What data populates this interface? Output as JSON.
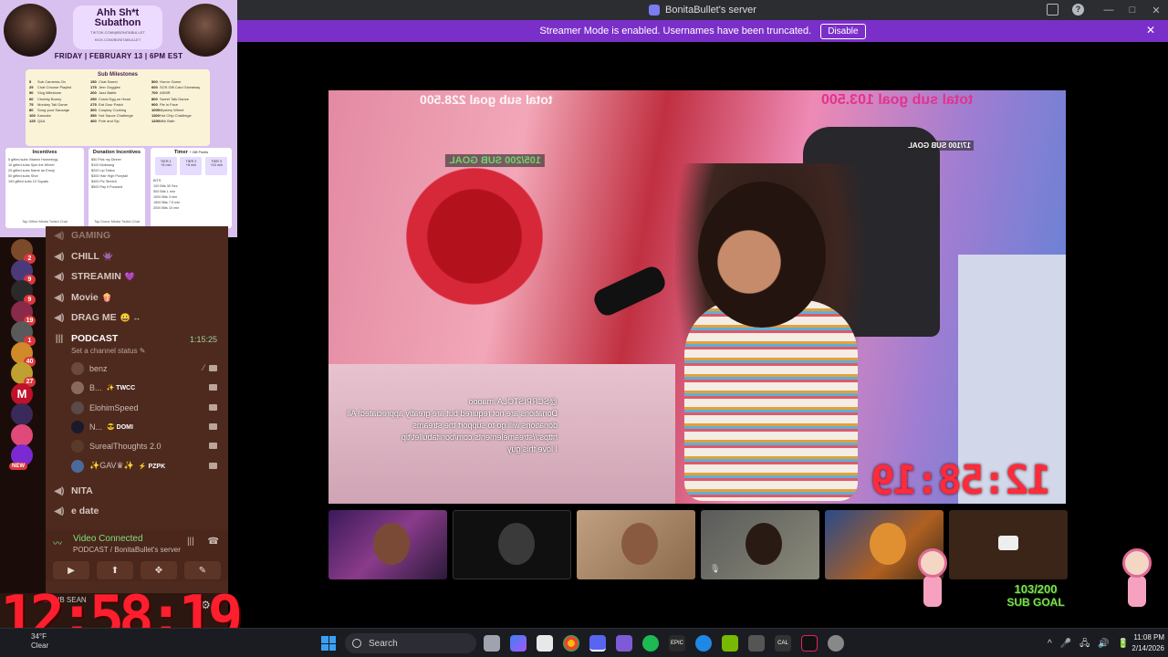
{
  "window": {
    "title": "BonitaBullet's server",
    "controls": [
      "—",
      "□",
      "✕"
    ]
  },
  "streamer_bar": {
    "message": "Streamer Mode is enabled. Usernames have been truncated.",
    "disable_label": "Disable",
    "close": "✕"
  },
  "poster": {
    "title": "Ahh Sh*t Subathon",
    "handle_tiktok": "TIKTOK.COM/@BONITABULLET",
    "handle_kick": "KICK.COM/BONITABULLET",
    "date": "FRIDAY | FEBRUARY 13 | 6PM EST",
    "milestones_title": "Sub Milestones",
    "milestones": [
      [
        [
          "5",
          "Sub Cameras On"
        ],
        [
          "25",
          "Chat Choose Playlist"
        ],
        [
          "50",
          "Vlog Milestone"
        ],
        [
          "60",
          "Chubby Bunny"
        ],
        [
          "75",
          "Monkey Tail Game"
        ],
        [
          "80",
          "Song your Sausage"
        ],
        [
          "100",
          "Karaoke"
        ],
        [
          "125",
          "Q&A"
        ]
      ],
      [
        [
          "150",
          "Chat Sweet"
        ],
        [
          "175",
          "Jeer Goggles"
        ],
        [
          "200",
          "Jazz Battle"
        ],
        [
          "250",
          "Crack Egg on Head"
        ],
        [
          "275",
          "Eat Sour Patch"
        ],
        [
          "300",
          "Cosplay Cooking"
        ],
        [
          "350",
          "Hot Sauce Challenge"
        ],
        [
          "400",
          "Pole and Sip"
        ]
      ],
      [
        [
          "500",
          "Horror Game"
        ],
        [
          "600",
          "SOS Gift Card Giveaway"
        ],
        [
          "700",
          "ASMR"
        ],
        [
          "800",
          "Sweet Talk Dance"
        ],
        [
          "900",
          "Pie in Face"
        ],
        [
          "1000",
          "Mystery Wheel"
        ],
        [
          "1100",
          "Hot Chip Challenge"
        ],
        [
          "1200",
          "Milk Bath"
        ]
      ]
    ],
    "incentives": {
      "title": "Incentives",
      "lines": [
        "5 gifted subs  Vitamin Hummingy",
        "10 gifted subs  Spin the Wheel",
        "20 gifted subs  Name an Emoji",
        "50 gifted subs  Shot",
        "100 gifted subs  10 Squats"
      ],
      "footer": "Tap Gifted   Media Twitch Chat"
    },
    "donations": {
      "title": "Donation Incentives",
      "lines": [
        "$50  Pick my Dinner",
        "$100  Mukbang",
        "$200  Lip Tattoo",
        "$300  Hair High Ponytail",
        "$400  Pic Stretch",
        "$500  Pay it Forward"
      ],
      "footer": "Tap Donor   Media Twitch Chat"
    },
    "timer": {
      "title": "Timer",
      "note": "+ Gift Points",
      "tiers": [
        [
          "TIER 1",
          "+5 min"
        ],
        [
          "TIER 2",
          "+8 min"
        ],
        [
          "TIER 3",
          "+15 min"
        ]
      ],
      "lines": [
        "BITS",
        "100 Bits  30 Sec",
        "500 Bits  1 min",
        "1000 Bits  3 min",
        "1500 Bits  7.5 min",
        "2000 Bits  10 min"
      ]
    }
  },
  "servers": [
    {
      "badge": "2"
    },
    {
      "badge": "9"
    },
    {
      "badge": "9"
    },
    {
      "badge": "19"
    },
    {
      "badge": "1"
    },
    {
      "badge": "40"
    },
    {
      "badge": "27"
    },
    {
      "badge": "",
      "text": "M"
    },
    {
      "badge": ""
    },
    {
      "badge": ""
    },
    {
      "badge": "",
      "new": "NEW"
    }
  ],
  "channels": [
    {
      "label": "GAMING",
      "emoji": ""
    },
    {
      "label": "CHILL",
      "emoji": "👾"
    },
    {
      "label": "STREAMIN",
      "emoji": "💜"
    },
    {
      "label": "Movie",
      "emoji": "🍿"
    },
    {
      "label": "DRAG ME",
      "emoji": "😀 ↔"
    },
    {
      "label": "PODCAST",
      "emoji": ""
    },
    {
      "label": "NITA",
      "emoji": ""
    },
    {
      "label": "e date",
      "emoji": ""
    }
  ],
  "podcast": {
    "timer": "1:15:25",
    "status": "Set a channel status ✎",
    "users": [
      {
        "name": "benz",
        "tag": ""
      },
      {
        "name": "B...",
        "tag": "✨ TWCC"
      },
      {
        "name": "ElohimSpeed",
        "tag": ""
      },
      {
        "name": "N...",
        "tag": "😎 DOMI"
      },
      {
        "name": "SurealThoughts 2.0",
        "tag": ""
      },
      {
        "name": "✨GAV♛✨",
        "tag": "⚡ PZPK"
      }
    ]
  },
  "voice": {
    "status": "Video Connected",
    "server": "PODCAST / BonitaBullet's server",
    "buttons": [
      "▶",
      "⬆",
      "✥",
      "✎"
    ]
  },
  "user_panel": {
    "name": "B...",
    "status": "SUB SEAN",
    "gear": "⚙"
  },
  "stream": {
    "goal_left": "total sub goal 228.500",
    "goal_right": "total sub goal 103.500",
    "small_goal": "105/200 SUB GOAL",
    "small_goal2": "17/100 SUB GOAL",
    "clock": "12:58:19",
    "chat": "@SCRPISTOLA lmaooo\nDonations are not required but are greatly appreciated! All donations will go to support the streams\nhttps://streamelements.com/bonitabullet/tip\nI love this guy",
    "sub_goal_value": "103/200",
    "sub_goal_label": "SUB GOAL"
  },
  "big_clock": "12:58:19",
  "taskbar": {
    "weather_temp": "34°F",
    "weather_desc": "Clear",
    "search": "Search",
    "time": "11:08 PM",
    "date": "2/14/2026",
    "tray": [
      "^",
      "🎤",
      "🖧",
      "🔊",
      "🔋"
    ]
  }
}
